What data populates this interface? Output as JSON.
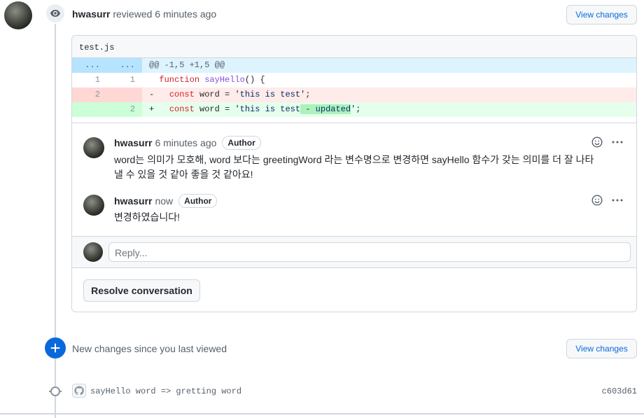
{
  "review": {
    "user": "hwasurr",
    "action_text": "reviewed 6 minutes ago",
    "view_changes_label": "View changes"
  },
  "diff": {
    "filename": "test.js",
    "hunk": {
      "left": "...",
      "right": "...",
      "text": "@@ -1,5 +1,5 @@"
    },
    "lines": [
      {
        "type": "context",
        "old": "1",
        "new": "1",
        "sign": " ",
        "text": "function sayHello() {"
      },
      {
        "type": "del",
        "old": "2",
        "new": "",
        "sign": "-",
        "text": "const word = 'this is test';"
      },
      {
        "type": "add",
        "old": "",
        "new": "2",
        "sign": "+",
        "text": "const word = 'this is test - updated';"
      }
    ]
  },
  "comments": [
    {
      "user": "hwasurr",
      "time": "6 minutes ago",
      "badge": "Author",
      "body_line1": "word는 의미가 모호해, word 보다는 greetingWord 라는 변수명으로 변경하면 sayHello 함수가 갖는 의미를 더 잘 나타",
      "body_line2": "낼 수 있을 것 같아 좋을 것 같아요!"
    },
    {
      "user": "hwasurr",
      "time": "now",
      "badge": "Author",
      "body_line1": "변경하였습니다!"
    }
  ],
  "reply": {
    "placeholder": "Reply..."
  },
  "resolve": {
    "label": "Resolve conversation"
  },
  "new_changes": {
    "text": "New changes since you last viewed",
    "view_changes_label": "View changes"
  },
  "commit": {
    "message": "sayHello word => gretting word",
    "sha": "c603d61"
  },
  "icons": {
    "review": "eye-icon",
    "new_changes": "plus-icon",
    "commit": "github-mark-icon",
    "reaction": "smiley-icon",
    "more": "kebab-horizontal-icon"
  },
  "colors": {
    "accent": "#0969da",
    "del_bg": "#ffebe9",
    "add_bg": "#e6ffec",
    "hunk_bg": "#ddf4ff"
  }
}
